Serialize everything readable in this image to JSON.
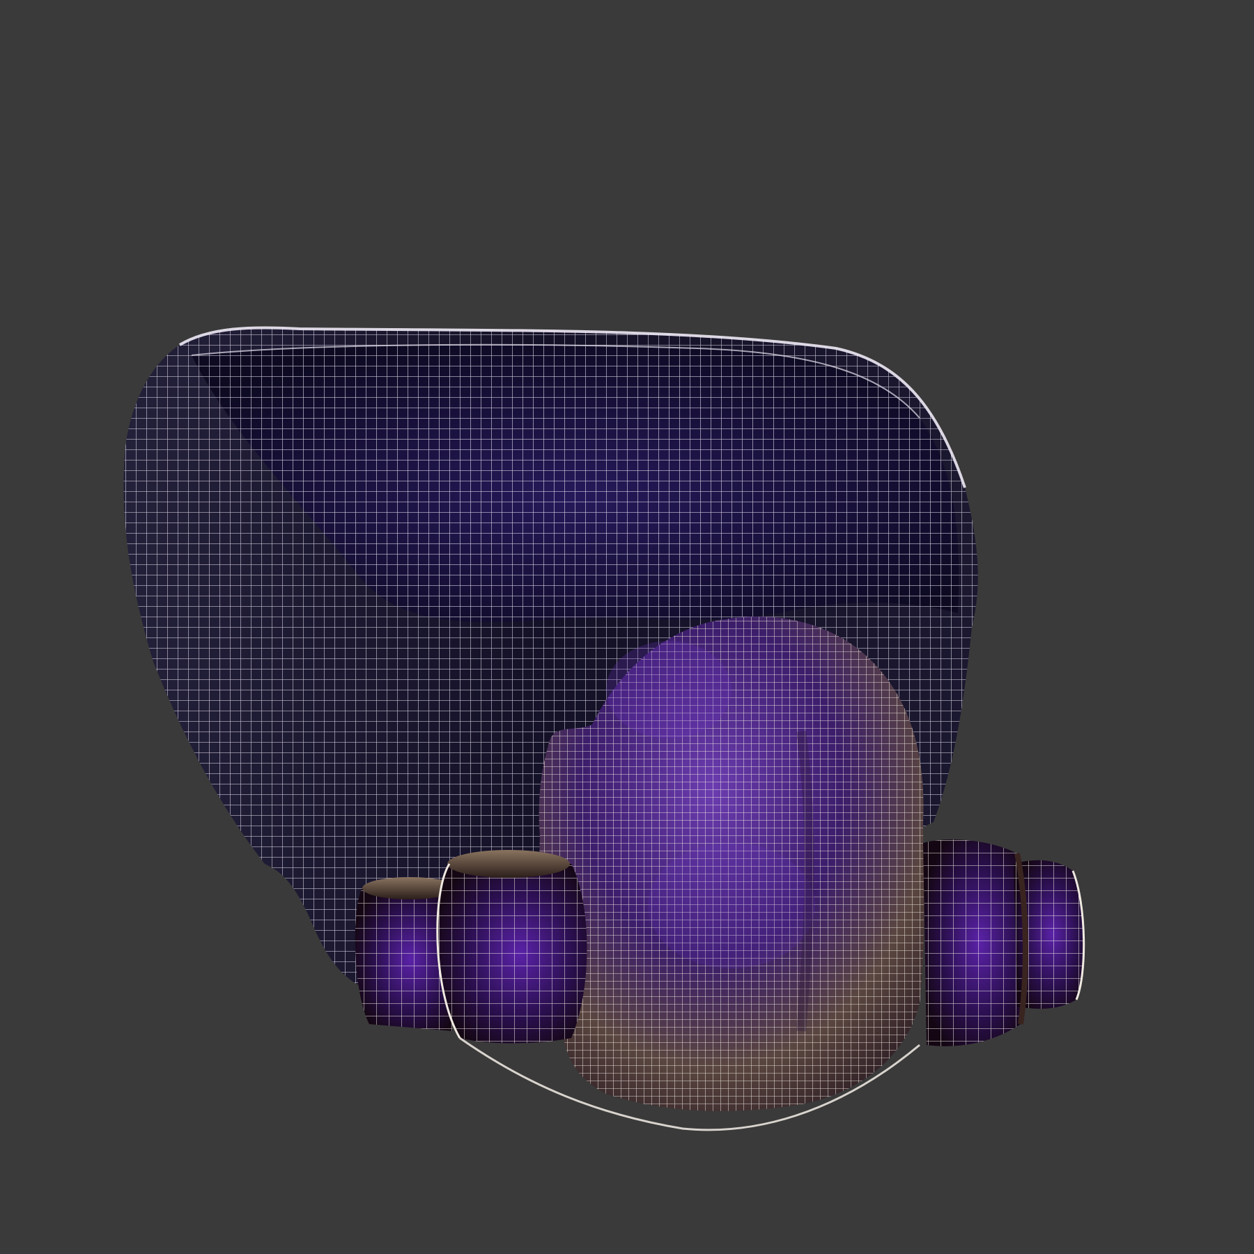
{
  "viewport": {
    "background_color": "#3a3a3a"
  },
  "model": {
    "subject": "wireframe-respirator-mask",
    "colors": {
      "wire": "#f2ecf6",
      "shell_inner": "#14102e",
      "shell_outer": "#1c1836",
      "purple": "#4a1f8c",
      "purple_dark": "#1c0b33",
      "tan": "#7a6552"
    }
  }
}
